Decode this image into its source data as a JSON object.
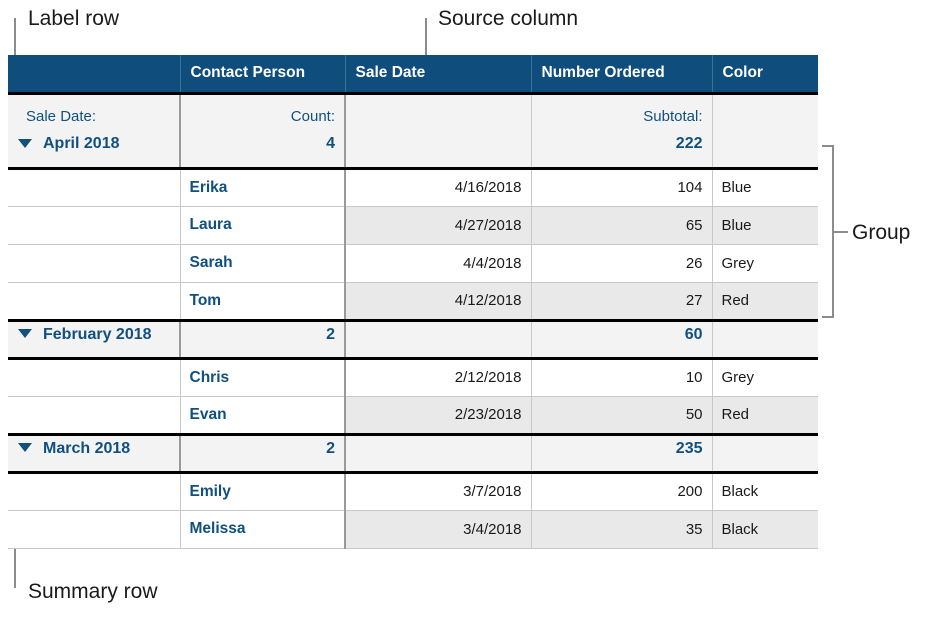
{
  "annotations": {
    "label_row": "Label row",
    "source_column": "Source column",
    "group": "Group",
    "summary_row": "Summary row"
  },
  "table": {
    "columns": [
      "",
      "Contact Person",
      "Sale Date",
      "Number Ordered",
      "Color"
    ],
    "label_row": {
      "category_label": "Sale Date:",
      "count_label": "Count:",
      "date_label": "",
      "subtotal_label": "Subtotal:",
      "color_label": ""
    },
    "groups": [
      {
        "name": "April 2018",
        "count": "4",
        "subtotal": "222",
        "disclosure": "triangle-down-icon",
        "rows": [
          {
            "contact": "Erika",
            "date": "4/16/2018",
            "number": "104",
            "color": "Blue"
          },
          {
            "contact": "Laura",
            "date": "4/27/2018",
            "number": "65",
            "color": "Blue"
          },
          {
            "contact": "Sarah",
            "date": "4/4/2018",
            "number": "26",
            "color": "Grey"
          },
          {
            "contact": "Tom",
            "date": "4/12/2018",
            "number": "27",
            "color": "Red"
          }
        ]
      },
      {
        "name": "February 2018",
        "count": "2",
        "subtotal": "60",
        "disclosure": "triangle-down-icon",
        "rows": [
          {
            "contact": "Chris",
            "date": "2/12/2018",
            "number": "10",
            "color": "Grey"
          },
          {
            "contact": "Evan",
            "date": "2/23/2018",
            "number": "50",
            "color": "Red"
          }
        ]
      },
      {
        "name": "March 2018",
        "count": "2",
        "subtotal": "235",
        "disclosure": "triangle-down-icon",
        "rows": [
          {
            "contact": "Emily",
            "date": "3/7/2018",
            "number": "200",
            "color": "Black"
          },
          {
            "contact": "Melissa",
            "date": "3/4/2018",
            "number": "35",
            "color": "Black"
          }
        ]
      }
    ]
  },
  "colors": {
    "header_background": "#0f4d7c",
    "header_text": "#ffffff",
    "accent_text": "#10507f",
    "summary_background": "#f3f3f3",
    "stripe_background": "#e9e9e9",
    "body_text": "#1a1a1a",
    "callout_line": "#8c8c8c",
    "heavy_rule": "#000000"
  }
}
